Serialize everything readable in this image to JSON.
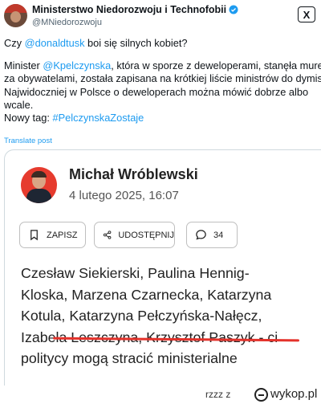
{
  "tweet": {
    "author_name": "Ministerstwo Niedorozwoju i Technofobii",
    "handle": "@MNiedorozwoju",
    "line1_prefix": "Czy ",
    "line1_mention": "@donaldtusk",
    "line1_suffix": " boi się silnych kobiet?",
    "p2_l1_prefix": "Minister ",
    "p2_l1_mention": "@Kpelczynska",
    "p2_l1_suffix": ", która w sporze z deweloperami, stanęła murem",
    "p2_l2": "za obywatelami, została zapisana na krótkiej liście ministrów do dymisji.",
    "p2_l3": "Najwidoczniej w Polsce o deweloperach można mówić dobrze albo",
    "p2_l4": "wcale.",
    "tag_prefix": "Nowy tag: ",
    "tag": "#PelczynskaZostaje",
    "translate": "Translate post"
  },
  "embedded_post": {
    "name": "Michał Wróblewski",
    "date": "4 lutego 2025, 16:07",
    "save_label": "ZAPISZ",
    "share_label": "UDOSTĘPNIJ",
    "comments_count": "34",
    "lines": [
      "Czesław Siekierski, Paulina Hennig-",
      "Kloska, Marzena Czarnecka, Katarzyna",
      "Kotula, ",
      "Katarzyna Pełczyńska-Nałęcz,",
      "Izabela Leszczyna, Krzysztof Paszyk - ci",
      "politycy mogą stracić ministerialne"
    ]
  },
  "footer": {
    "user": "rzzz",
    "separator": "z",
    "brand": "wykop.pl"
  },
  "colors": {
    "link": "#1d9bf0",
    "underline": "#e4322b",
    "verified": "#1d9bf0"
  }
}
